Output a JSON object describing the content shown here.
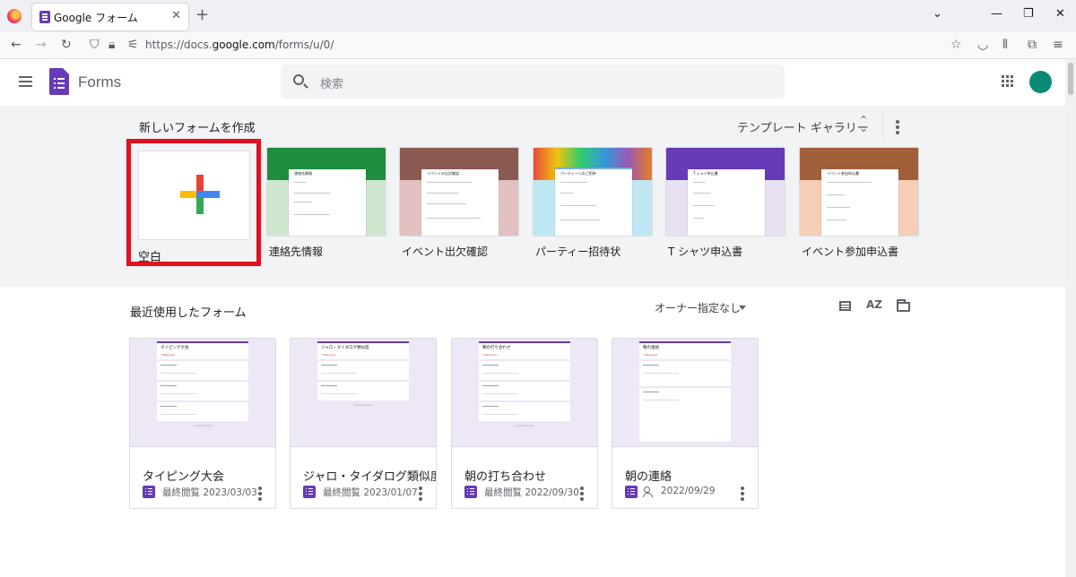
{
  "browser": {
    "tab_title": "Google フォーム",
    "url_prefix": "https://docs.",
    "url_domain": "google.com",
    "url_path": "/forms/u/0/"
  },
  "header": {
    "app_name": "Forms",
    "search_placeholder": "検索",
    "accent_color": "#673ab7"
  },
  "gallery": {
    "title": "新しいフォームを作成",
    "gallery_label": "テンプレート ギャラリー",
    "templates": [
      {
        "label": "空白"
      },
      {
        "label": "連絡先情報",
        "form_title": "連絡先情報",
        "color": "#1e8e3e",
        "band": "#cfe6cf"
      },
      {
        "label": "イベント出欠確認",
        "form_title": "イベントの出欠確認",
        "color": "#8d5a52",
        "band": "#e2c1c1"
      },
      {
        "label": "パーティー招待状",
        "form_title": "パーティーへのご招待",
        "color": "#7fb0d6",
        "band": "#bfe7f4"
      },
      {
        "label": "T シャツ申込書",
        "form_title": "T シャツ申込書",
        "color": "#673ab7",
        "band": "#e7e1f1"
      },
      {
        "label": "イベント参加申込書",
        "form_title": "イベント参加申込書",
        "color": "#a0603a",
        "band": "#f6cdb7"
      }
    ]
  },
  "recent": {
    "title": "最近使用したフォーム",
    "owner_filter": "オーナー指定なし",
    "sort_label": "AZ",
    "forms": [
      {
        "title": "タイピング大会",
        "date": "最終閲覧 2023/03/03",
        "shared": false
      },
      {
        "title": "ジャロ・タイダログ類似度",
        "date": "最終閲覧 2023/01/07",
        "shared": false
      },
      {
        "title": "朝の打ち合わせ",
        "date": "最終閲覧 2022/09/30",
        "shared": false
      },
      {
        "title": "朝の連絡",
        "date": "2022/09/29",
        "shared": true
      }
    ],
    "footer_brand": "Google Forms"
  }
}
